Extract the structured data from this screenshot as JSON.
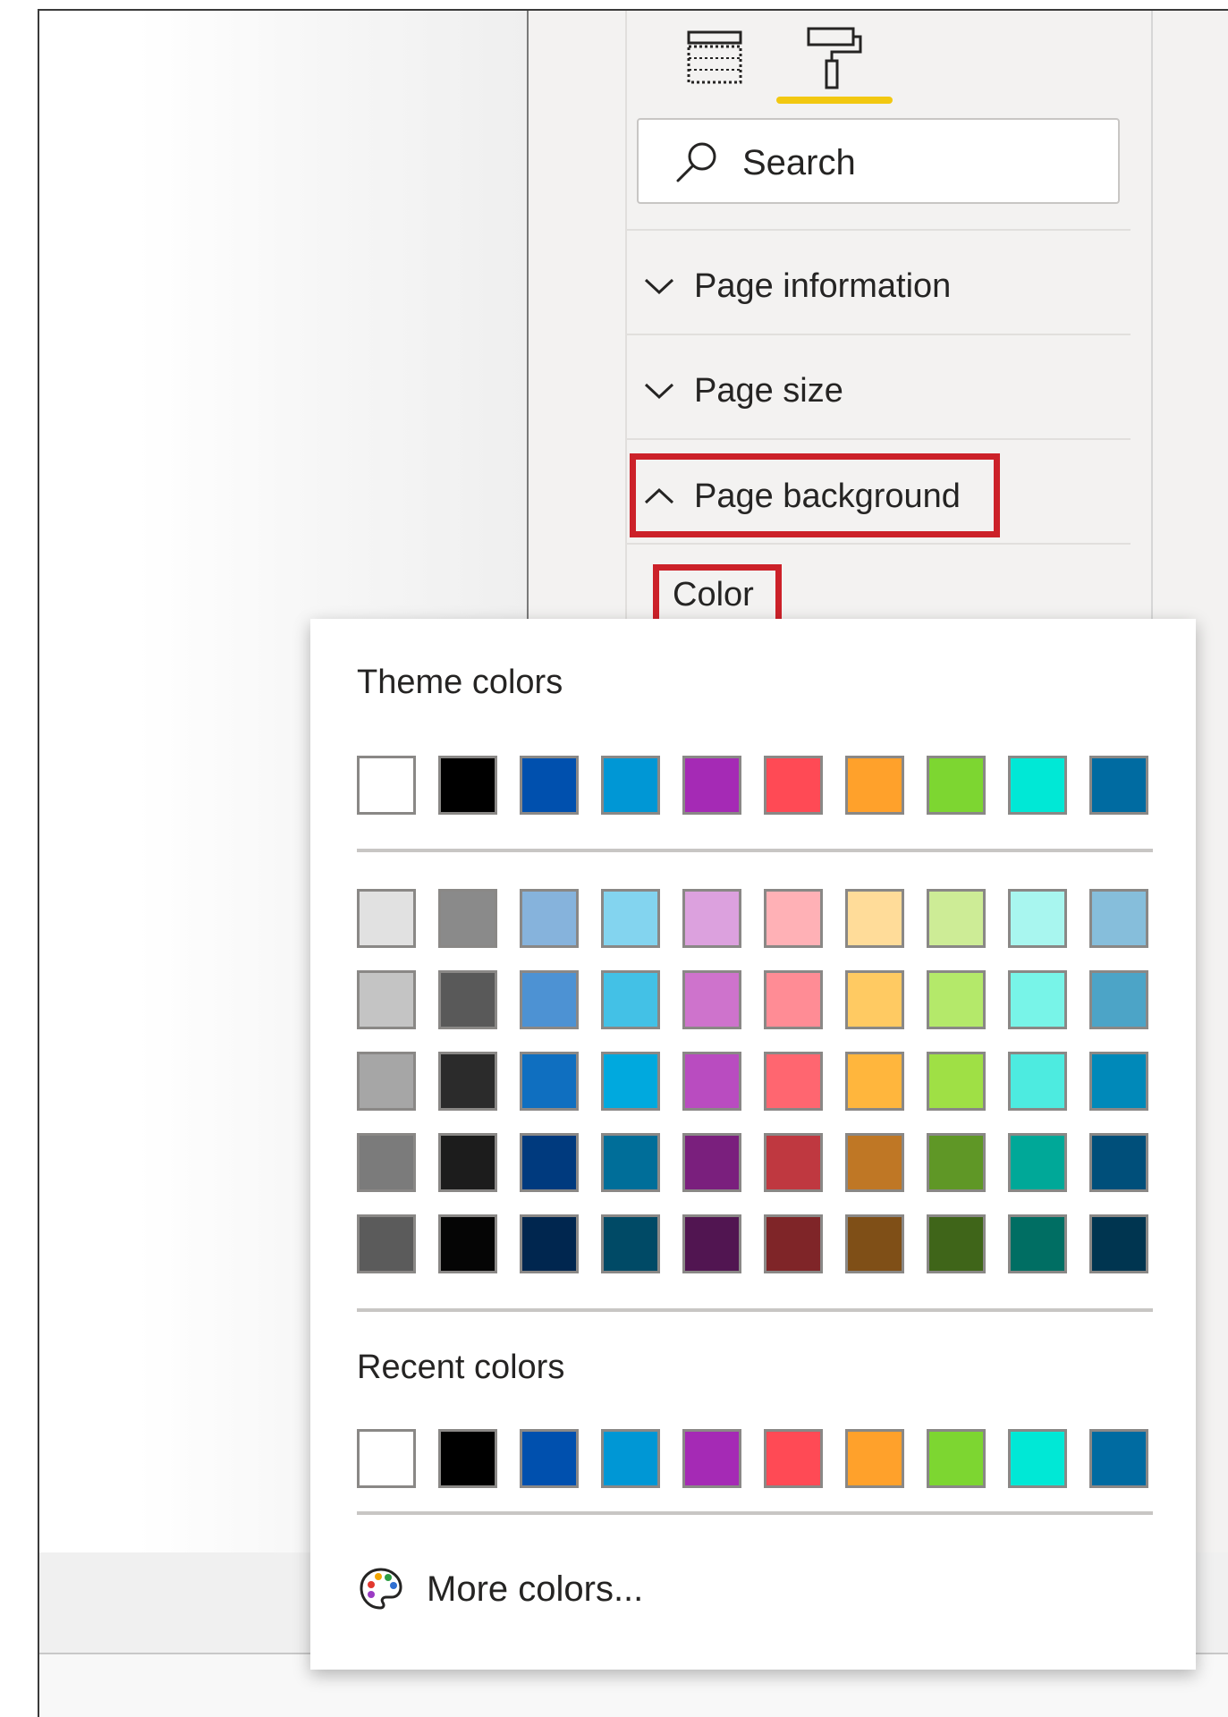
{
  "pane": {
    "tabs": [
      {
        "name": "fields",
        "icon": "table-icon"
      },
      {
        "name": "format",
        "icon": "paint-roller-icon",
        "active": true
      }
    ],
    "accent": "#f2c811",
    "search": {
      "label": "Search",
      "icon": "search-icon"
    },
    "sections": [
      {
        "label": "Page information",
        "expanded": false
      },
      {
        "label": "Page size",
        "expanded": false
      },
      {
        "label": "Page background",
        "expanded": true
      }
    ],
    "color_label": "Color",
    "highlight_color": "#cc2129"
  },
  "color_picker": {
    "theme_heading": "Theme colors",
    "theme_colors": [
      "#ffffff",
      "#000000",
      "#0050ae",
      "#0097d5",
      "#a52ab5",
      "#ff4a55",
      "#ffa12b",
      "#7dd631",
      "#00e8d6",
      "#006ba1"
    ],
    "shades": [
      [
        "#e1e1e1",
        "#8a8a8a",
        "#86b3dc",
        "#83d4ef",
        "#dca1de",
        "#ffb1b6",
        "#ffdc99",
        "#cdec96",
        "#a8f6ef",
        "#86bedb"
      ],
      [
        "#c4c4c4",
        "#595959",
        "#4d92d3",
        "#43c1e6",
        "#ce73cc",
        "#ff8c95",
        "#ffca62",
        "#b4e96a",
        "#78f4e8",
        "#4ca4c7"
      ],
      [
        "#a6a6a6",
        "#2b2b2b",
        "#0f6fc0",
        "#00a9de",
        "#b94cc0",
        "#ff6670",
        "#ffb63d",
        "#9fe045",
        "#4debe0",
        "#0089b9"
      ],
      [
        "#7b7b7b",
        "#1c1c1c",
        "#003a7e",
        "#006e99",
        "#7a1f7d",
        "#bf3840",
        "#bf7725",
        "#5f9726",
        "#00a898",
        "#004f7a"
      ],
      [
        "#5b5b5b",
        "#050505",
        "#00264f",
        "#004a66",
        "#511551",
        "#7f2528",
        "#7f4f17",
        "#3f6519",
        "#006e63",
        "#003550"
      ]
    ],
    "recent_heading": "Recent colors",
    "recent_colors": [
      "#ffffff",
      "#000000",
      "#0050ae",
      "#0097d5",
      "#a52ab5",
      "#ff4a55",
      "#ffa12b",
      "#7dd631",
      "#00e8d6",
      "#006ba1"
    ],
    "more_label": "More colors...",
    "more_icon": "palette-icon"
  }
}
